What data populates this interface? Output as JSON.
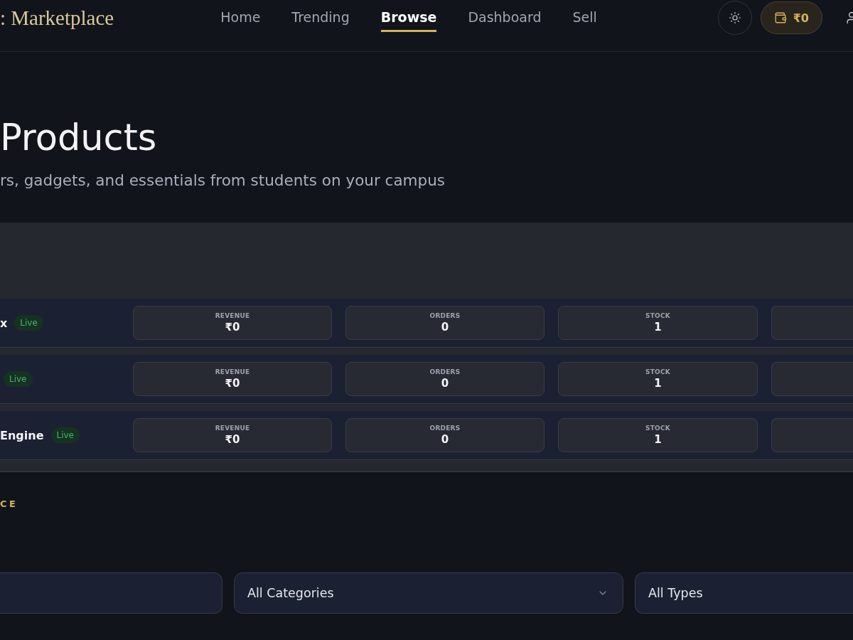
{
  "header": {
    "logo": ": Marketplace",
    "nav": [
      {
        "label": "Home",
        "selected": false
      },
      {
        "label": "Trending",
        "selected": false
      },
      {
        "label": "Browse",
        "selected": true
      },
      {
        "label": "Dashboard",
        "selected": false
      },
      {
        "label": "Sell",
        "selected": false
      }
    ],
    "wallet": "₹0"
  },
  "hero": {
    "title": "Products",
    "subtitle": "rs, gadgets, and essentials from students on your campus"
  },
  "listings": [
    {
      "name": "x",
      "status": "Live",
      "stats": [
        {
          "label": "REVENUE",
          "value": "₹0"
        },
        {
          "label": "ORDERS",
          "value": "0"
        },
        {
          "label": "STOCK",
          "value": "1"
        }
      ]
    },
    {
      "status": "Live",
      "stats": [
        {
          "label": "REVENUE",
          "value": "₹0"
        },
        {
          "label": "ORDERS",
          "value": "0"
        },
        {
          "label": "STOCK",
          "value": "1"
        }
      ]
    },
    {
      "name": "Engine",
      "status": "Live",
      "stats": [
        {
          "label": "REVENUE",
          "value": "₹0"
        },
        {
          "label": "ORDERS",
          "value": "0"
        },
        {
          "label": "STOCK",
          "value": "1"
        }
      ]
    }
  ],
  "section_label": "CE",
  "filters": {
    "category": "All Categories",
    "type": "All Types"
  }
}
